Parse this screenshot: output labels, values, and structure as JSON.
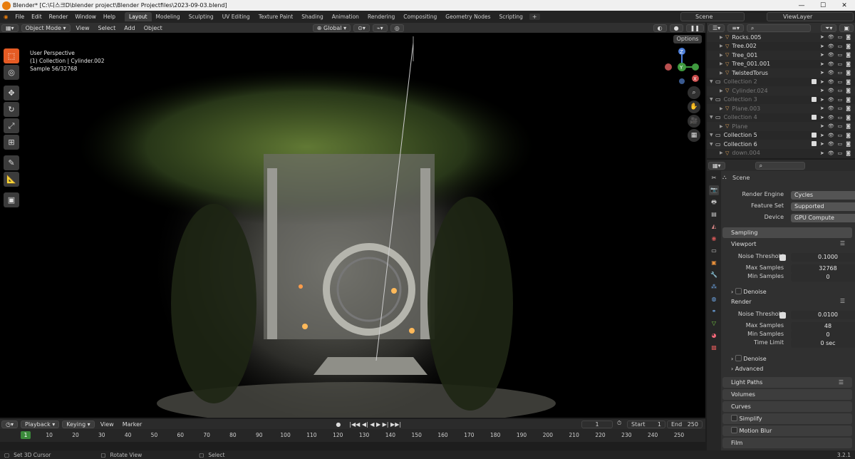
{
  "titlebar": {
    "title": "Blender* [C:\\디스크D\\blender project\\Blender Projectfiles\\2023-09-03.blend]",
    "minimize": "—",
    "maximize": "☐",
    "close": "✕"
  },
  "menu": {
    "items": [
      "File",
      "Edit",
      "Render",
      "Window",
      "Help"
    ]
  },
  "workspaces": [
    "Layout",
    "Modeling",
    "Sculpting",
    "UV Editing",
    "Texture Paint",
    "Shading",
    "Animation",
    "Rendering",
    "Compositing",
    "Geometry Nodes",
    "Scripting"
  ],
  "active_workspace": "Layout",
  "scene_name": "Scene",
  "view_layer": "ViewLayer",
  "viewport": {
    "mode": "Object Mode",
    "menus": [
      "View",
      "Select",
      "Add",
      "Object"
    ],
    "transform_orientation": "Global",
    "options": "Options",
    "perspective": "User Perspective",
    "collection": "(1) Collection | Cylinder.002",
    "sample": "Sample 56/32768"
  },
  "gizmo": {
    "x": "X",
    "y": "Y",
    "z": "Z"
  },
  "timeline": {
    "menus": [
      "Playback",
      "Keying",
      "View",
      "Marker"
    ],
    "ticks": [
      "1",
      "10",
      "20",
      "30",
      "40",
      "50",
      "60",
      "70",
      "80",
      "90",
      "100",
      "110",
      "120",
      "130",
      "140",
      "150",
      "160",
      "170",
      "180",
      "190",
      "200",
      "210",
      "220",
      "230",
      "240",
      "250"
    ],
    "current_frame": "1",
    "start_label": "Start",
    "start": "1",
    "end_label": "End",
    "end": "250"
  },
  "status": {
    "items": [
      "Set 3D Cursor",
      "Rotate View",
      "Select"
    ],
    "version": "3.2.1"
  },
  "outliner": {
    "rows": [
      {
        "name": "Rocks.005",
        "dim": false,
        "type": "obj"
      },
      {
        "name": "Tree.002",
        "dim": false,
        "type": "obj"
      },
      {
        "name": "Tree_001",
        "dim": false,
        "type": "obj"
      },
      {
        "name": "Tree_001.001",
        "dim": false,
        "type": "obj"
      },
      {
        "name": "TwistedTorus",
        "dim": false,
        "type": "obj"
      },
      {
        "name": "Collection 2",
        "dim": true,
        "type": "col"
      },
      {
        "name": "Cylinder.024",
        "dim": true,
        "type": "obj"
      },
      {
        "name": "Collection 3",
        "dim": true,
        "type": "col"
      },
      {
        "name": "Plane.003",
        "dim": true,
        "type": "obj"
      },
      {
        "name": "Collection 4",
        "dim": true,
        "type": "col"
      },
      {
        "name": "Plane",
        "dim": true,
        "type": "obj"
      },
      {
        "name": "Collection 5",
        "dim": false,
        "type": "col"
      },
      {
        "name": "Collection 6",
        "dim": false,
        "type": "col"
      },
      {
        "name": "down.004",
        "dim": true,
        "type": "obj"
      }
    ]
  },
  "properties": {
    "context": "Scene",
    "render_engine": {
      "label": "Render Engine",
      "value": "Cycles"
    },
    "feature_set": {
      "label": "Feature Set",
      "value": "Supported"
    },
    "device": {
      "label": "Device",
      "value": "GPU Compute"
    },
    "sampling": "Sampling",
    "viewport_sub": "Viewport",
    "vp_noise": {
      "label": "Noise Threshold",
      "value": "0.1000"
    },
    "vp_max": {
      "label": "Max Samples",
      "value": "32768"
    },
    "vp_min": {
      "label": "Min Samples",
      "value": "0"
    },
    "denoise": "Denoise",
    "render_sub": "Render",
    "r_noise": {
      "label": "Noise Threshold",
      "value": "0.0100"
    },
    "r_max": {
      "label": "Max Samples",
      "value": "48"
    },
    "r_min": {
      "label": "Min Samples",
      "value": "0"
    },
    "r_time": {
      "label": "Time Limit",
      "value": "0 sec"
    },
    "denoise2": "Denoise",
    "advanced": "Advanced",
    "light_paths": "Light Paths",
    "volumes": "Volumes",
    "curves": "Curves",
    "simplify": "Simplify",
    "motion_blur": "Motion Blur",
    "film": "Film"
  },
  "colors": {
    "accent": "#e55b24",
    "active_tab": "#3d3d3d",
    "frame_marker": "#3b8a3b"
  }
}
